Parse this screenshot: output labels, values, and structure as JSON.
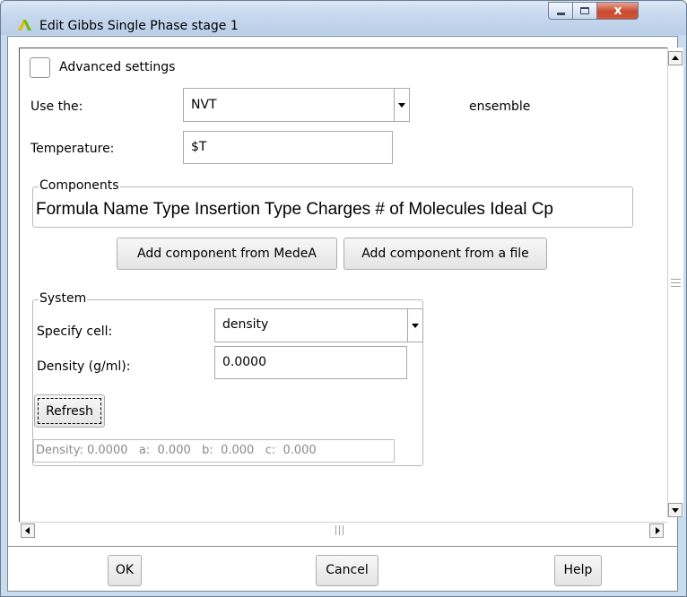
{
  "window": {
    "title": "Edit Gibbs Single Phase stage 1",
    "app_icon": "yellow-green-chevron-icon",
    "controls": [
      "minimize-icon",
      "maximize-icon",
      "close-icon"
    ]
  },
  "advanced": {
    "label": "Advanced settings",
    "checked": false
  },
  "ensemble": {
    "prefix_label": "Use the:",
    "selected": "NVT",
    "suffix_label": "ensemble"
  },
  "temperature": {
    "label": "Temperature:",
    "value": "$T"
  },
  "components": {
    "legend": "Components",
    "header": "Formula Name Type Insertion Type Charges # of Molecules Ideal Cp",
    "add_medea_label": "Add component from MedeA",
    "add_file_label": "Add component from a file"
  },
  "system": {
    "legend": "System",
    "specify_label": "Specify cell:",
    "specify_value": "density",
    "density_label": "Density (g/ml):",
    "density_value": "0.0000",
    "refresh_label": "Refresh",
    "summary": {
      "density_label": "Density:",
      "density": "0.0000",
      "a_label": "a:",
      "a": "0.000",
      "b_label": "b:",
      "b": "0.000",
      "c_label": "c:",
      "c": "0.000"
    }
  },
  "footer": {
    "ok_label": "OK",
    "cancel_label": "Cancel",
    "help_label": "Help"
  },
  "colors": {
    "titlebar": "#c6d8ee",
    "close_button": "#c9492e",
    "disabled_text": "#8a8a8a"
  }
}
